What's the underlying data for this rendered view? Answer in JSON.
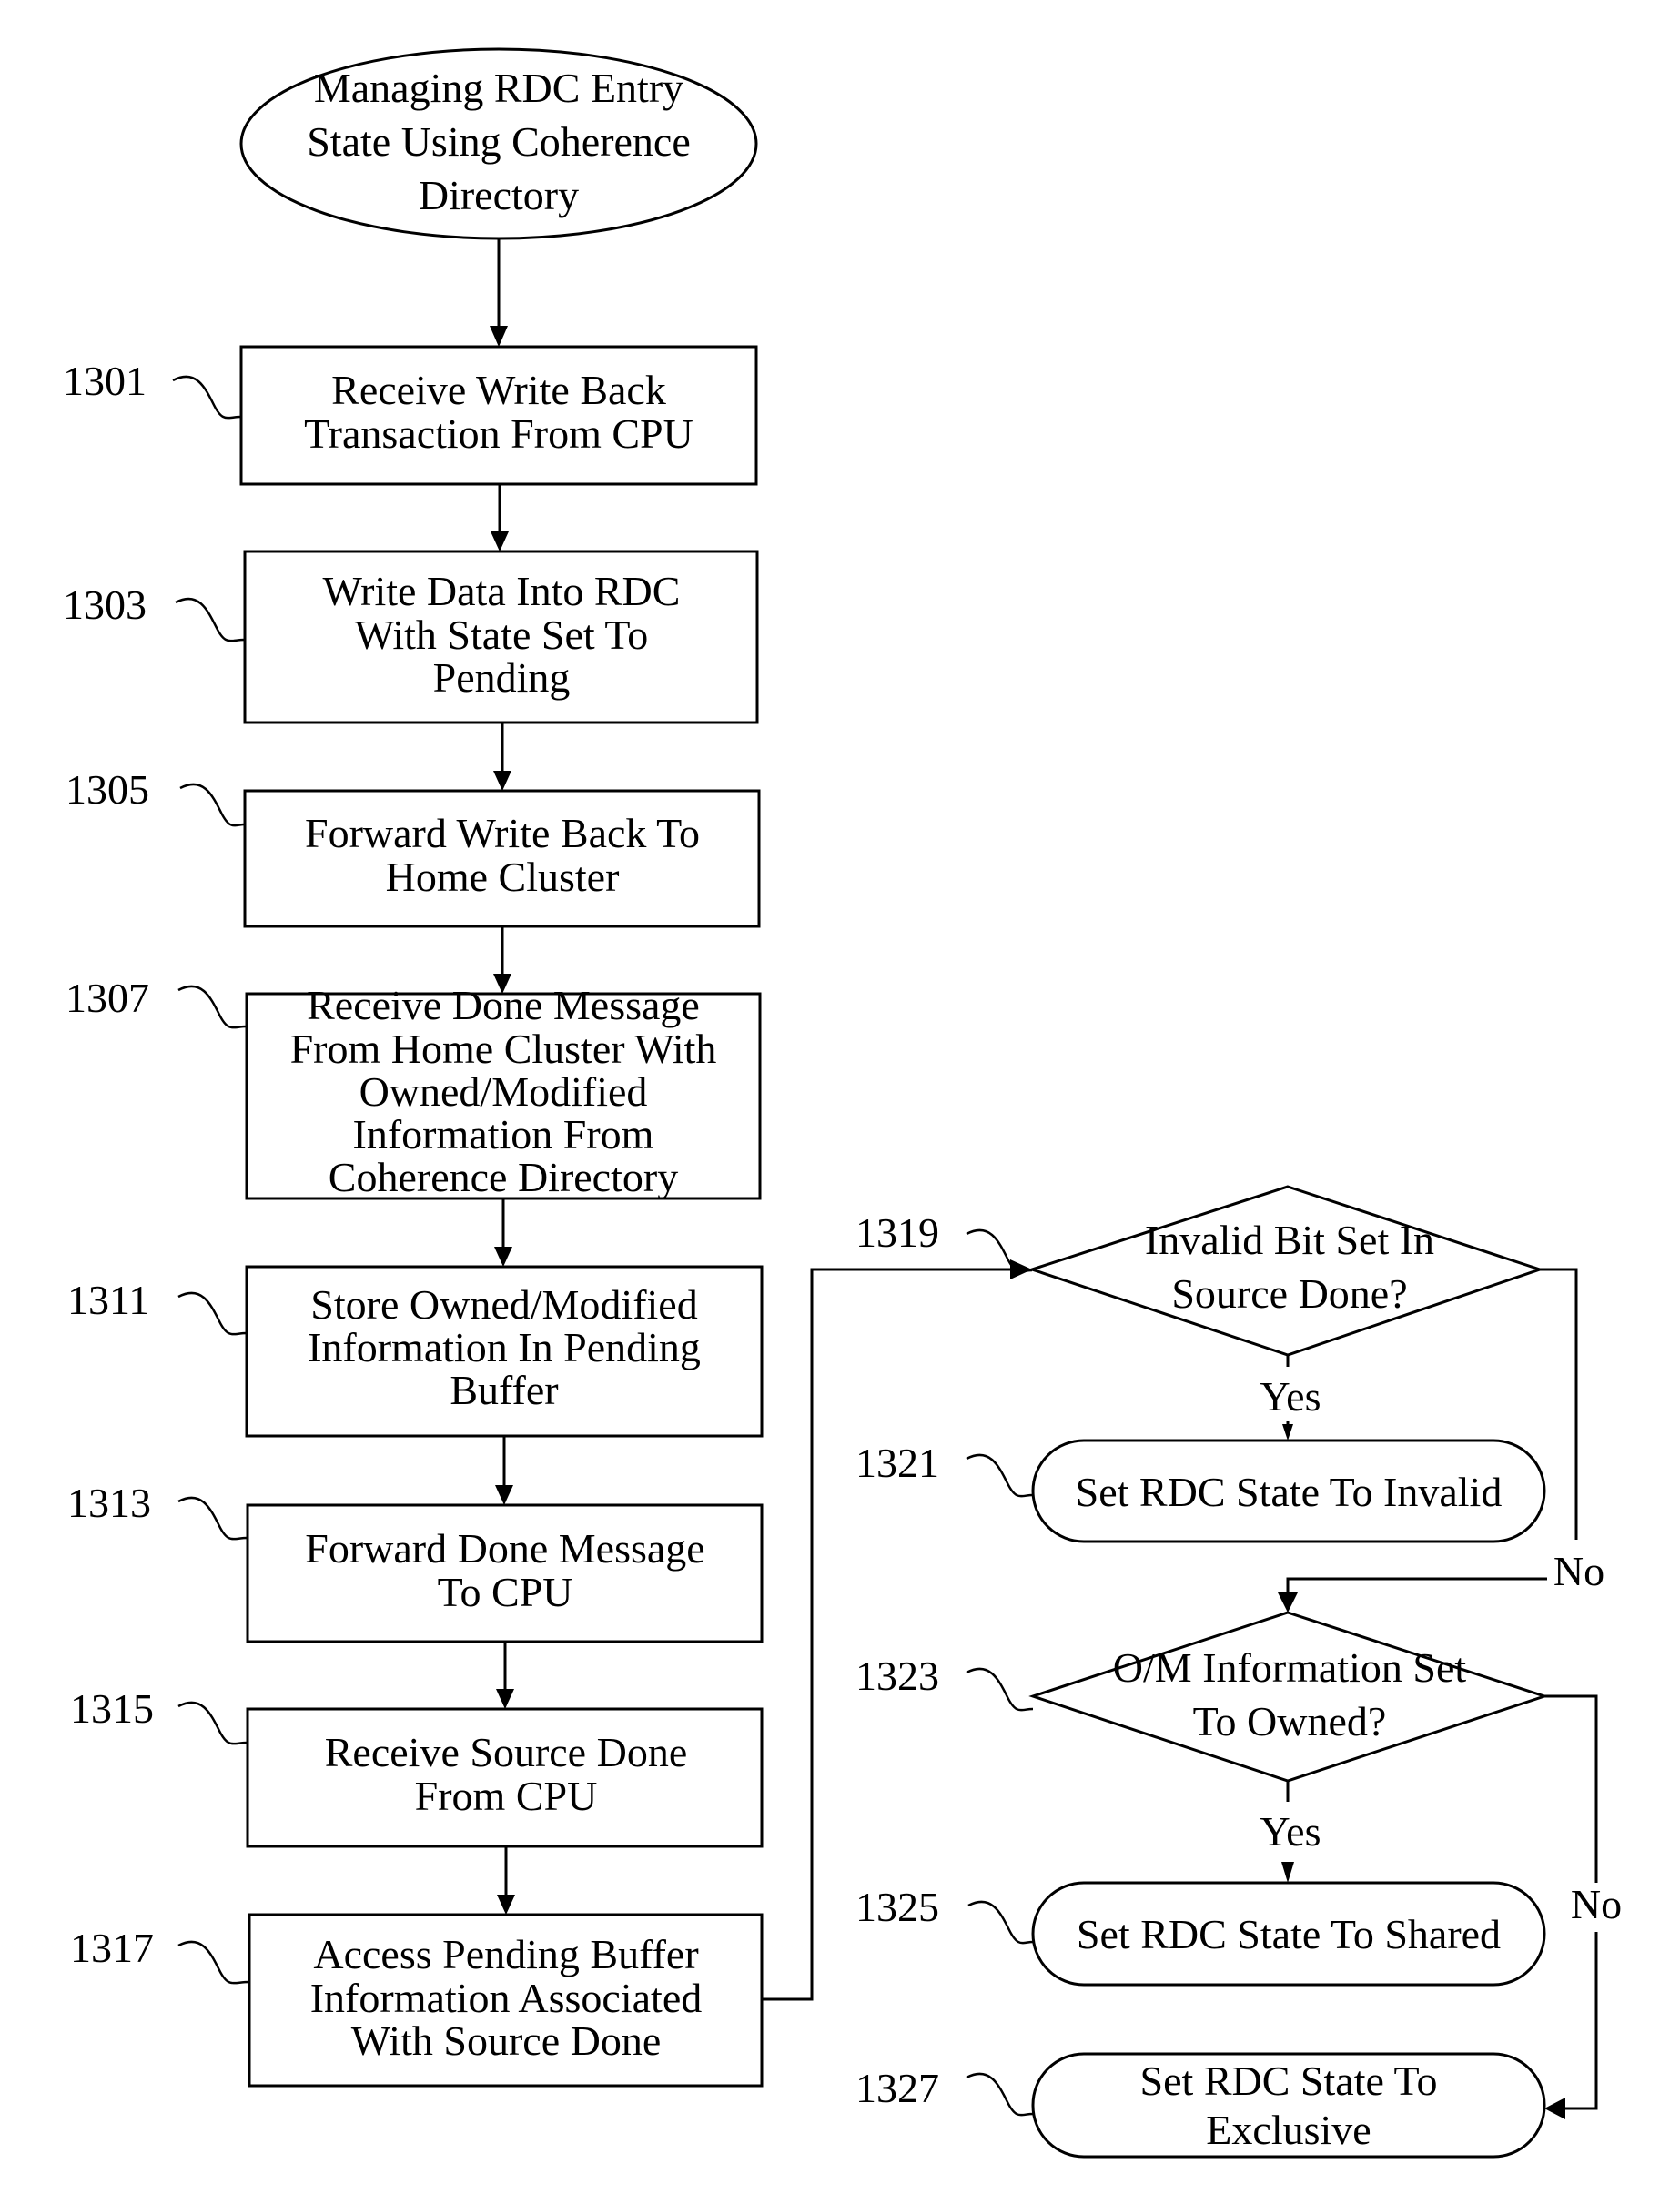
{
  "diagram": {
    "type": "flowchart",
    "start": {
      "lines": [
        "Managing RDC Entry",
        "State Using Coherence",
        "Directory"
      ]
    },
    "steps": [
      {
        "id": "1301",
        "lines": [
          "Receive Write Back",
          "Transaction From CPU"
        ]
      },
      {
        "id": "1303",
        "lines": [
          "Write Data Into RDC",
          "With State Set To",
          "Pending"
        ]
      },
      {
        "id": "1305",
        "lines": [
          "Forward Write Back To",
          "Home Cluster"
        ]
      },
      {
        "id": "1307",
        "lines": [
          "Receive Done Message",
          "From Home Cluster With",
          "Owned/Modified",
          "Information From",
          "Coherence Directory"
        ]
      },
      {
        "id": "1311",
        "lines": [
          "Store Owned/Modified",
          "Information In Pending",
          "Buffer"
        ]
      },
      {
        "id": "1313",
        "lines": [
          "Forward Done Message",
          "To CPU"
        ]
      },
      {
        "id": "1315",
        "lines": [
          "Receive Source Done",
          "From CPU"
        ]
      },
      {
        "id": "1317",
        "lines": [
          "Access Pending Buffer",
          "Information Associated",
          "With Source Done"
        ]
      }
    ],
    "decisions": [
      {
        "id": "1319",
        "lines": [
          "Invalid Bit Set In",
          "Source Done?"
        ],
        "yes_label": "Yes",
        "no_label": "No"
      },
      {
        "id": "1323",
        "lines": [
          "O/M Information Set",
          "To Owned?"
        ],
        "yes_label": "Yes",
        "no_label": "No"
      }
    ],
    "terminals": [
      {
        "id": "1321",
        "lines": [
          "Set RDC State To Invalid"
        ]
      },
      {
        "id": "1325",
        "lines": [
          "Set RDC State To Shared"
        ]
      },
      {
        "id": "1327",
        "lines": [
          "Set RDC State To",
          "Exclusive"
        ]
      }
    ]
  }
}
